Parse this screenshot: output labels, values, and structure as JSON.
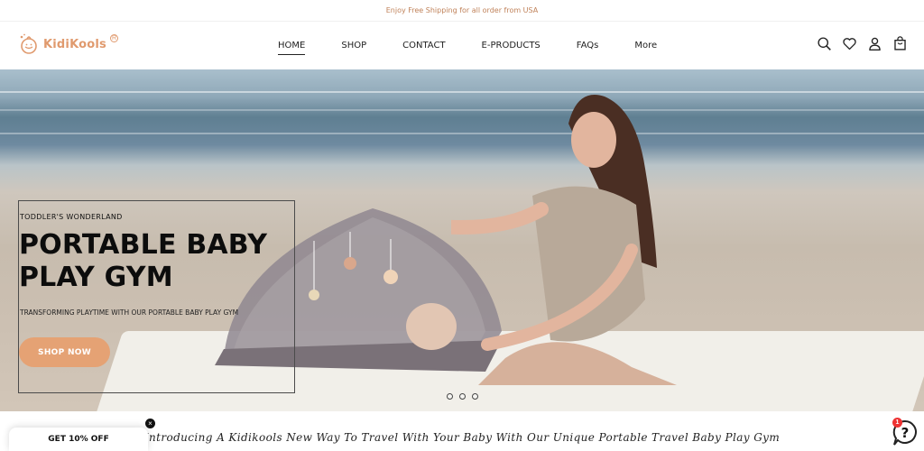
{
  "announcement": "Enjoy Free Shipping for all order from USA",
  "brand": {
    "name": "KidiKools",
    "registered": "R"
  },
  "nav": [
    {
      "label": "HOME",
      "active": true
    },
    {
      "label": "SHOP"
    },
    {
      "label": "CONTACT"
    },
    {
      "label": "E-PRODUCTS"
    },
    {
      "label": "FAQs"
    },
    {
      "label": "More"
    }
  ],
  "header_icons": [
    "search-icon",
    "heart-icon",
    "user-icon",
    "cart-icon"
  ],
  "hero": {
    "eyebrow": "TODDLER'S WONDERLAND",
    "title": "PORTABLE BABY PLAY GYM",
    "subtitle": "TRANSFORMING PLAYTIME WITH OUR PORTABLE BABY PLAY GYM",
    "cta": "SHOP NOW",
    "slides": 3,
    "active_slide": 1
  },
  "intro": "Introducing A Kidikools New Way To Travel With Your Baby With Our Unique Portable Travel Baby Play Gym",
  "promo": {
    "label": "GET 10% OFF",
    "close": "×"
  },
  "help_widget": {
    "badge": "1",
    "icon": "?"
  },
  "colors": {
    "accent": "#e5a274",
    "announcement": "#c0825a",
    "logo": "#e09a6e"
  }
}
